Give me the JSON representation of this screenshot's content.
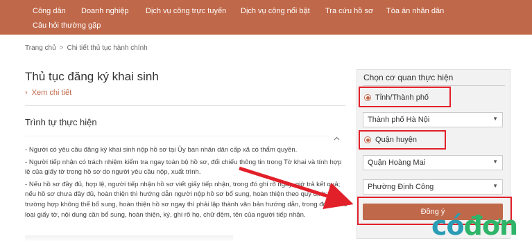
{
  "nav": {
    "items": [
      "Công dân",
      "Doanh nghiệp",
      "Dịch vụ công trực tuyến",
      "Dịch vụ công nổi bật",
      "Tra cứu hồ sơ",
      "Tòa án nhân dân",
      "Câu hỏi thường gặp"
    ]
  },
  "breadcrumb": {
    "home": "Trang chủ",
    "separator": ">",
    "current": "Chi tiết thủ tục hành chính"
  },
  "main": {
    "title": "Thủ tục đăng ký khai sinh",
    "detail_chevron": "›",
    "detail_link": "Xem chi tiết",
    "section_title": "Trình tự thực hiện",
    "collapse_icon": "chevron-up-icon",
    "paragraphs": [
      "- Người có yêu cầu đăng ký khai sinh nộp hồ sơ tại Ủy ban nhân dân cấp xã có thẩm quyền.",
      "- Người tiếp nhận có trách nhiệm kiểm tra ngay toàn bộ hồ sơ, đối chiếu thông tin trong Tờ khai và tính hợp lệ của giấy tờ trong hồ sơ do người yêu cầu nộp, xuất trình.",
      "- Nếu hồ sơ đầy đủ, hợp lệ, người tiếp nhận hồ sơ viết giấy tiếp nhận, trong đó ghi rõ ngày, giờ trả kết quả; nếu hồ sơ chưa đầy đủ, hoàn thiện thì hướng dẫn người nộp hồ sơ bổ sung, hoàn thiện theo quy định; trường hợp không thể bổ sung, hoàn thiện hồ sơ ngay thì phải lập thành văn bản hướng dẫn, trong đó nêu rõ loại giấy tờ, nội dung cần bổ sung, hoàn thiện, ký, ghi rõ họ, chữ đệm, tên của người tiếp nhận."
    ]
  },
  "panel": {
    "title": "Chọn cơ quan thực hiện",
    "province_radio_label": "Tỉnh/Thành phố",
    "province_value": "Thành phố Hà Nội",
    "district_radio_label": "Quận huyện",
    "district_value": "Quận Hoàng Mai",
    "ward_value": "Phường Định Công",
    "submit_label": "Đồng ý",
    "caret_icon": "▼"
  },
  "logo": {
    "part1": "có",
    "part2": "đơn"
  },
  "colors": {
    "brand": "#c0684a",
    "highlight": "#e2202a",
    "logo_blue": "#2a9db4",
    "logo_green": "#2fb56a"
  }
}
